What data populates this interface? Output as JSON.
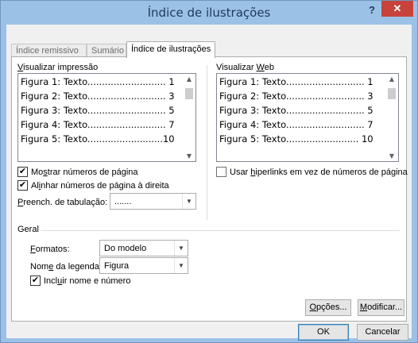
{
  "window": {
    "title": "Índice de ilustrações",
    "help": "?",
    "close": "✕"
  },
  "tabs": [
    {
      "label": "Índice remissivo"
    },
    {
      "label": "Sumário"
    },
    {
      "label": "Índice de ilustrações"
    }
  ],
  "print_preview": {
    "label_u": "V",
    "label_rest": "isualizar impressão",
    "lines": [
      "Figura 1: Texto........................... 1",
      "Figura 2: Texto........................... 3",
      "Figura 3: Texto........................... 5",
      "Figura 4: Texto........................... 7",
      "Figura 5: Texto..........................10"
    ]
  },
  "web_preview": {
    "label_pre": "Visualizar ",
    "label_u": "W",
    "label_rest": "eb",
    "lines": [
      "Figura 1: Texto........................... 1",
      "Figura 2: Texto........................... 3",
      "Figura 3: Texto........................... 5",
      "Figura 4: Texto........................... 7",
      "Figura 5: Texto......................... 10"
    ]
  },
  "options": {
    "show_page_numbers": {
      "checked": true,
      "pre": "Mo",
      "u": "s",
      "rest": "trar números de página"
    },
    "right_align": {
      "checked": true,
      "pre": "Al",
      "u": "i",
      "rest": "nhar números de página à direita"
    },
    "tab_leader": {
      "pre": "",
      "u": "P",
      "rest": "reench. de tabulação:",
      "value": "......."
    },
    "use_hyperlinks": {
      "checked": false,
      "pre": "Usar ",
      "u": "h",
      "rest": "iperlinks em vez de números de página"
    }
  },
  "general": {
    "heading": "Geral",
    "formats": {
      "u": "F",
      "rest": "ormatos:",
      "value": "Do modelo"
    },
    "caption_label": {
      "pre": "Nom",
      "u": "e",
      "rest": " da legenda:",
      "value": "Figura"
    },
    "include_label": {
      "checked": true,
      "pre": "Incl",
      "u": "u",
      "rest": "ir nome e número"
    }
  },
  "buttons": {
    "options": {
      "u": "O",
      "rest": "pções..."
    },
    "modify": {
      "u": "M",
      "rest": "odificar..."
    },
    "ok": "OK",
    "cancel": "Cancelar"
  },
  "colors": {
    "title_bar": "#9cc1e6",
    "close_button": "#c7423a",
    "dialog_bg": "#f0f0f0"
  }
}
